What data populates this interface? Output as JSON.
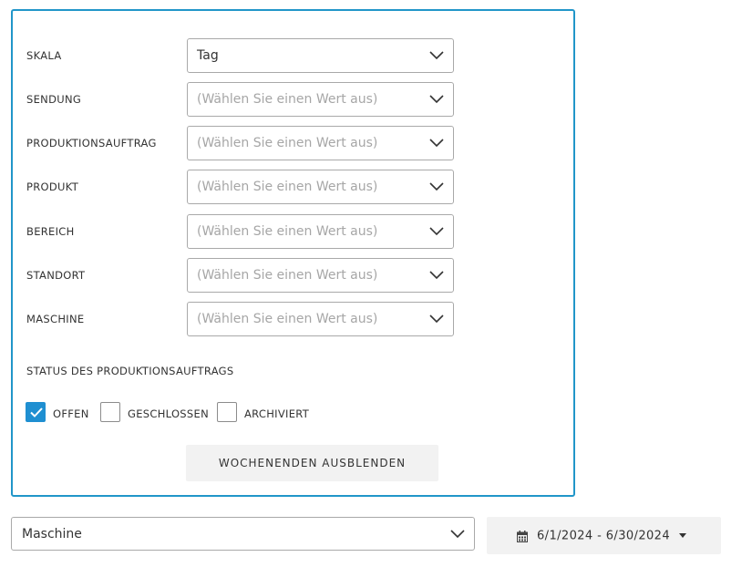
{
  "filters": [
    {
      "label": "SKALA",
      "value": "Tag",
      "placeholder": ""
    },
    {
      "label": "SENDUNG",
      "value": "",
      "placeholder": "(Wählen Sie einen Wert aus)"
    },
    {
      "label": "PRODUKTIONSAUFTRAG",
      "value": "",
      "placeholder": "(Wählen Sie einen Wert aus)"
    },
    {
      "label": "PRODUKT",
      "value": "",
      "placeholder": "(Wählen Sie einen Wert aus)"
    },
    {
      "label": "BEREICH",
      "value": "",
      "placeholder": "(Wählen Sie einen Wert aus)"
    },
    {
      "label": "STANDORT",
      "value": "",
      "placeholder": "(Wählen Sie einen Wert aus)"
    },
    {
      "label": "MASCHINE",
      "value": "",
      "placeholder": "(Wählen Sie einen Wert aus)"
    }
  ],
  "status": {
    "label": "STATUS DES PRODUKTIONSAUFTRAGS",
    "options": [
      {
        "label": "OFFEN",
        "checked": true
      },
      {
        "label": "GESCHLOSSEN",
        "checked": false
      },
      {
        "label": "ARCHIVIERT",
        "checked": false
      }
    ]
  },
  "hide_weekends_label": "WOCHENENDEN AUSBLENDEN",
  "group_by": {
    "value": "Maschine"
  },
  "date_range": {
    "label": "6/1/2024 - 6/30/2024",
    "icon": "calendar-icon"
  },
  "colors": {
    "accent": "#2196c9",
    "checkbox": "#1f8fd1",
    "button_bg": "#f2f2f2",
    "placeholder": "#a6a6a6"
  }
}
